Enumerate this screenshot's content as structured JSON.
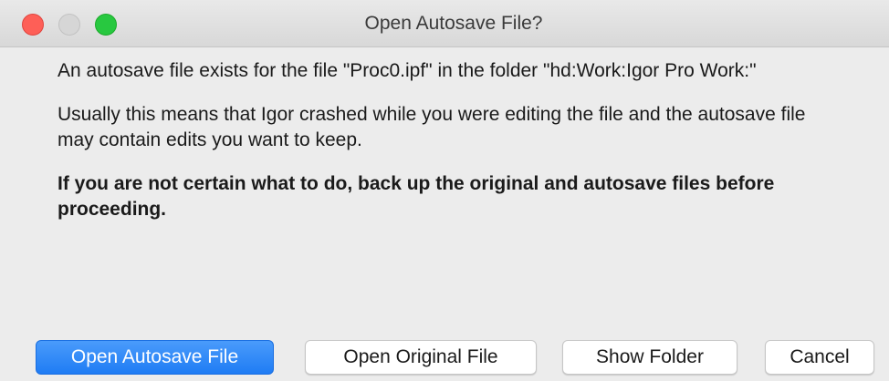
{
  "window": {
    "title": "Open Autosave File?"
  },
  "message": {
    "paragraph1": "An autosave file exists for the file \"Proc0.ipf\" in the folder \"hd:Work:Igor Pro Work:\"",
    "paragraph2": "Usually this means that Igor crashed while you were editing the file and the autosave file may contain edits you want to keep.",
    "warning": "If you are not certain what to do, back up the original and autosave files before proceeding."
  },
  "buttons": {
    "open_autosave": "Open Autosave File",
    "open_original": "Open Original File",
    "show_folder": "Show Folder",
    "cancel": "Cancel"
  },
  "colors": {
    "default_button": "#1f7cf4",
    "close": "#fe5f57",
    "minimize_disabled": "#d6d6d6",
    "zoom": "#28c840"
  }
}
